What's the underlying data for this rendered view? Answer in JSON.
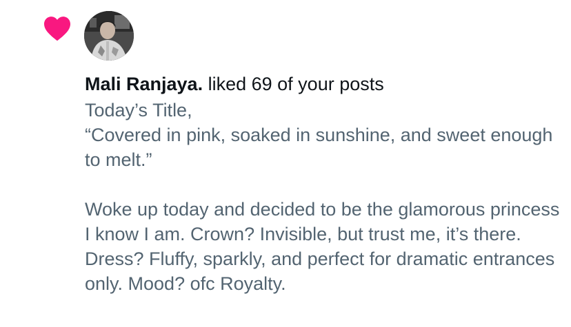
{
  "notification": {
    "type_icon": "heart-icon",
    "accent_color": "#f91880",
    "user": {
      "name": "Mali Ranjaya.",
      "avatar": "avatar"
    },
    "action_text": "liked 69 of your posts",
    "post_text": "Today’s Title,\n“Covered in pink, soaked in sunshine, and sweet enough to melt.”\n\nWoke up today and decided to be the glamorous princess I know I am. Crown? Invisible, but trust me, it’s there. Dress? Fluffy, sparkly, and perfect for dramatic entrances only. Mood? ofc Royalty."
  }
}
